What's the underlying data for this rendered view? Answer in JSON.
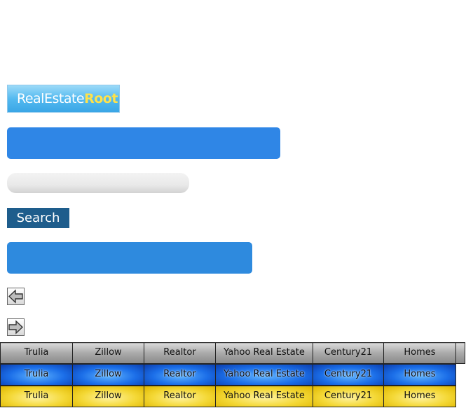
{
  "logo": {
    "text_main": "RealEstate",
    "text_accent": "Root"
  },
  "search": {
    "input_value": "",
    "input_placeholder": "",
    "button_label": "Search"
  },
  "arrows": {
    "prev_icon": "arrow-left-icon",
    "next_icon": "arrow-right-icon"
  },
  "link_rows": [
    {
      "style": "gray",
      "items": [
        "Trulia",
        "Zillow",
        "Realtor",
        "Yahoo Real Estate",
        "Century21",
        "Homes"
      ]
    },
    {
      "style": "blue",
      "items": [
        "Trulia",
        "Zillow",
        "Realtor",
        "Yahoo Real Estate",
        "Century21",
        "Homes"
      ]
    },
    {
      "style": "yellow",
      "items": [
        "Trulia",
        "Zillow",
        "Realtor",
        "Yahoo Real Estate",
        "Century21",
        "Homes"
      ]
    }
  ],
  "colors": {
    "bar_blue": "#2f86e6",
    "button_navy": "#1e5d8c",
    "logo_accent": "#ffe24a"
  }
}
